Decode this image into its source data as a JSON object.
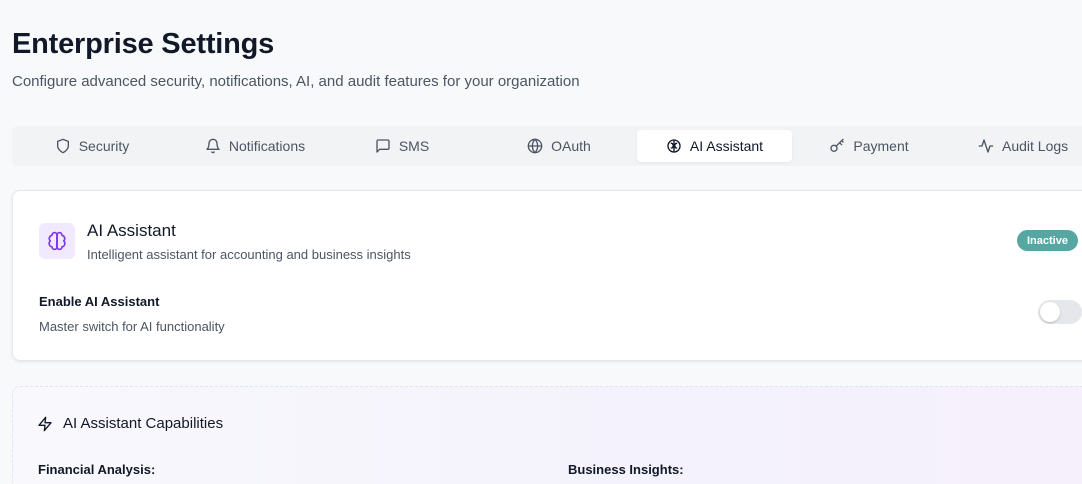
{
  "header": {
    "title": "Enterprise Settings",
    "subtitle": "Configure advanced security, notifications, AI, and audit features for your organization"
  },
  "tabs": [
    {
      "label": "Security",
      "icon": "shield-icon"
    },
    {
      "label": "Notifications",
      "icon": "bell-icon"
    },
    {
      "label": "SMS",
      "icon": "message-icon"
    },
    {
      "label": "OAuth",
      "icon": "globe-icon"
    },
    {
      "label": "AI Assistant",
      "icon": "brain-icon",
      "active": true
    },
    {
      "label": "Payment",
      "icon": "key-icon"
    },
    {
      "label": "Audit Logs",
      "icon": "activity-icon"
    }
  ],
  "ai_card": {
    "title": "AI Assistant",
    "description": "Intelligent assistant for accounting and business insights",
    "status": "Inactive",
    "enable_label": "Enable AI Assistant",
    "enable_description": "Master switch for AI functionality",
    "enabled": false
  },
  "capabilities": {
    "title": "AI Assistant Capabilities",
    "col1_heading": "Financial Analysis:",
    "col2_heading": "Business Insights:"
  },
  "colors": {
    "accent_purple": "#7c3aed",
    "badge_inactive": "#56a7a1"
  }
}
